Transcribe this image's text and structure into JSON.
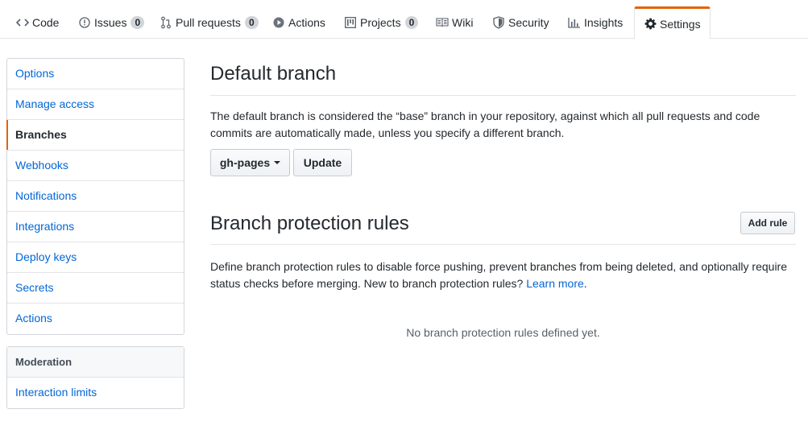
{
  "tabs": [
    {
      "label": "Code",
      "icon": "code-icon"
    },
    {
      "label": "Issues",
      "count": "0",
      "icon": "issue-opened-icon"
    },
    {
      "label": "Pull requests",
      "count": "0",
      "icon": "git-pull-request-icon"
    },
    {
      "label": "Actions",
      "icon": "play-icon"
    },
    {
      "label": "Projects",
      "count": "0",
      "icon": "project-icon"
    },
    {
      "label": "Wiki",
      "icon": "book-icon"
    },
    {
      "label": "Security",
      "icon": "shield-icon"
    },
    {
      "label": "Insights",
      "icon": "graph-icon"
    },
    {
      "label": "Settings",
      "icon": "gear-icon",
      "selected": true
    }
  ],
  "sidebar": {
    "items": [
      {
        "label": "Options"
      },
      {
        "label": "Manage access"
      },
      {
        "label": "Branches",
        "selected": true
      },
      {
        "label": "Webhooks"
      },
      {
        "label": "Notifications"
      },
      {
        "label": "Integrations"
      },
      {
        "label": "Deploy keys"
      },
      {
        "label": "Secrets"
      },
      {
        "label": "Actions"
      }
    ],
    "moderation": {
      "heading": "Moderation",
      "items": [
        {
          "label": "Interaction limits"
        }
      ]
    }
  },
  "default_branch": {
    "title": "Default branch",
    "description": "The default branch is considered the “base” branch in your repository, against which all pull requests and code commits are automatically made, unless you specify a different branch.",
    "branch_select": "gh-pages",
    "update_label": "Update"
  },
  "protection": {
    "title": "Branch protection rules",
    "add_rule_label": "Add rule",
    "description": "Define branch protection rules to disable force pushing, prevent branches from being deleted, and optionally require status checks before merging. New to branch protection rules?",
    "learn_more": "Learn more",
    "period": ".",
    "empty": "No branch protection rules defined yet."
  },
  "colors": {
    "accent": "#e36209",
    "link": "#0366d6",
    "text": "#24292e",
    "muted": "#586069",
    "border": "#e1e4e8"
  }
}
